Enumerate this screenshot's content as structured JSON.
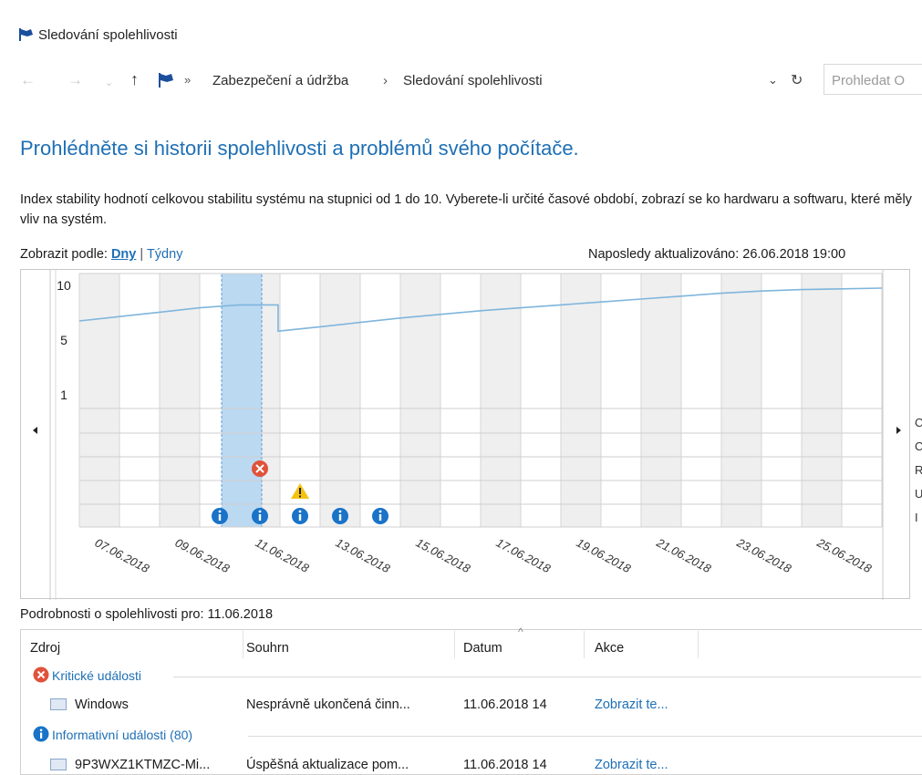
{
  "window": {
    "title": "Sledování spolehlivosti"
  },
  "addressbar": {
    "breadcrumb": [
      "Zabezpečení a údržba",
      "Sledování spolehlivosti"
    ],
    "separator": "›",
    "search_placeholder": "Prohledat O"
  },
  "main": {
    "heading": "Prohlédněte si historii spolehlivosti a problémů svého počítače.",
    "description": "Index stability hodnotí celkovou stabilitu systému na stupnici od 1 do 10. Vyberete-li určité časové období, zobrazí se ko hardwaru a softwaru, které měly vliv na systém.",
    "viewby_label": "Zobrazit podle:",
    "viewby_days": "Dny",
    "viewby_sep": "|",
    "viewby_weeks": "Týdny",
    "last_updated": "Naposledy aktualizováno: 26.06.2018 19:00"
  },
  "chart_data": {
    "type": "line",
    "y_ticks": [
      "10",
      "5",
      "1"
    ],
    "x_labels": [
      "07.06.2018",
      "09.06.2018",
      "11.06.2018",
      "13.06.2018",
      "15.06.2018",
      "17.06.2018",
      "19.06.2018",
      "21.06.2018",
      "23.06.2018",
      "25.06.2018"
    ],
    "columns": 20,
    "selected_column_index": 4,
    "stability_index": [
      7.0,
      7.3,
      7.6,
      7.9,
      8.1,
      6.3,
      6.6,
      6.9,
      7.2,
      7.45,
      7.7,
      7.9,
      8.1,
      8.3,
      8.5,
      8.7,
      8.9,
      9.05,
      9.15,
      9.2,
      9.25
    ],
    "events": [
      {
        "column": 4,
        "row": "critical",
        "icon": "error-icon"
      },
      {
        "column": 5,
        "row": "warning",
        "icon": "warning-icon"
      },
      {
        "column": 3,
        "row": "info",
        "icon": "info-icon"
      },
      {
        "column": 4,
        "row": "info",
        "icon": "info-icon"
      },
      {
        "column": 5,
        "row": "info",
        "icon": "info-icon"
      },
      {
        "column": 6,
        "row": "info",
        "icon": "info-icon"
      },
      {
        "column": 7,
        "row": "info",
        "icon": "info-icon"
      }
    ],
    "right_legend_letters": [
      "C",
      "C",
      "R",
      "U",
      "I"
    ],
    "colors": {
      "line": "#7fb5dc",
      "selected": "#bcd9f2",
      "selected_border": "#5b9bd5",
      "stripe": "#efefef",
      "error": "#e0533a",
      "warning": "#f5c211",
      "info": "#1a73c7"
    }
  },
  "details": {
    "title": "Podrobnosti o spolehlivosti pro: 11.06.2018",
    "columns": [
      "Zdroj",
      "Souhrn",
      "Datum",
      "Akce"
    ],
    "sort_indicator": "^",
    "groups": [
      {
        "label": "Kritické události",
        "icon": "error-icon",
        "rows": [
          {
            "source": "Windows",
            "summary": "Nesprávně ukončená činn...",
            "date": "11.06.2018 14",
            "action": "Zobrazit te..."
          }
        ]
      },
      {
        "label": "Informativní události (80)",
        "icon": "info-icon",
        "rows": [
          {
            "source": "9P3WXZ1KTMZC-Mi...",
            "summary": "Úspěšná aktualizace pom...",
            "date": "11.06.2018 14",
            "action": "Zobrazit te..."
          }
        ]
      }
    ]
  }
}
